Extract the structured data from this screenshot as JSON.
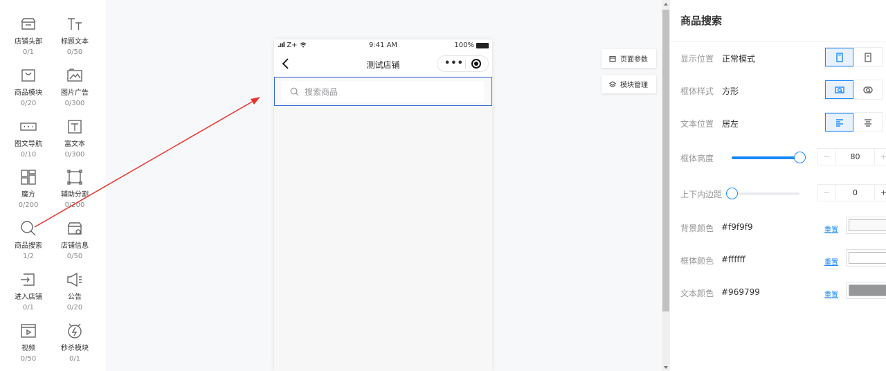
{
  "palette": {
    "items": [
      {
        "label": "店铺头部",
        "count": "0/1",
        "icon": "storefront-icon"
      },
      {
        "label": "标题文本",
        "count": "0/50",
        "icon": "title-text-icon"
      },
      {
        "label": "商品模块",
        "count": "0/20",
        "icon": "shopping-bag-icon"
      },
      {
        "label": "图片广告",
        "count": "0/300",
        "icon": "image-ad-icon"
      },
      {
        "label": "图文导航",
        "count": "0/10",
        "icon": "nav-icon"
      },
      {
        "label": "富文本",
        "count": "0/300",
        "icon": "rich-text-icon"
      },
      {
        "label": "魔方",
        "count": "0/200",
        "icon": "cube-grid-icon"
      },
      {
        "label": "辅助分割",
        "count": "0/200",
        "icon": "divider-icon"
      },
      {
        "label": "商品搜索",
        "count": "1/2",
        "icon": "search-icon"
      },
      {
        "label": "店铺信息",
        "count": "0/50",
        "icon": "store-info-icon"
      },
      {
        "label": "进入店铺",
        "count": "0/1",
        "icon": "enter-store-icon"
      },
      {
        "label": "公告",
        "count": "0/20",
        "icon": "megaphone-icon"
      },
      {
        "label": "视频",
        "count": "0/50",
        "icon": "video-icon"
      },
      {
        "label": "秒杀模块",
        "count": "0/1",
        "icon": "flash-sale-icon"
      }
    ]
  },
  "phone": {
    "status": {
      "signal": "Z+",
      "time": "9:41 AM",
      "battery": "100%"
    },
    "title": "测试店铺",
    "search_placeholder": "搜索商品"
  },
  "canvas_buttons": {
    "page_params": "页面参数",
    "module_manage": "模块管理"
  },
  "panel": {
    "title": "商品搜索",
    "display_position": {
      "label": "显示位置",
      "value": "正常模式"
    },
    "frame_style": {
      "label": "框体样式",
      "value": "方形"
    },
    "text_position": {
      "label": "文本位置",
      "value": "居左"
    },
    "frame_height": {
      "label": "框体高度",
      "value": "80",
      "level": 1.0
    },
    "padding": {
      "label": "上下内边距",
      "value": "0",
      "level": 0.0
    },
    "bg_color": {
      "label": "背景颜色",
      "value": "#f9f9f9",
      "reset": "重置"
    },
    "frame_color": {
      "label": "框体颜色",
      "value": "#ffffff",
      "reset": "重置"
    },
    "text_color": {
      "label": "文本颜色",
      "value": "#969799",
      "reset": "重置"
    },
    "stepper_minus": "−",
    "stepper_plus": "+"
  },
  "colors": {
    "accent": "#1989fa",
    "annotation_arrow": "#e8322b"
  }
}
